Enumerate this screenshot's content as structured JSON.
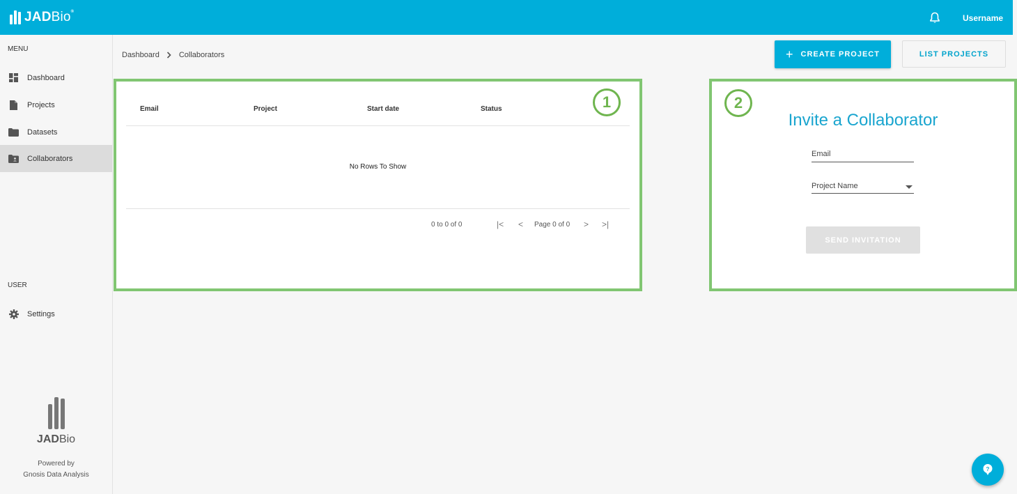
{
  "app": {
    "logo_text_bold": "JAD",
    "logo_text_light": "Bio",
    "logo_mark": "®"
  },
  "header": {
    "username": "Username",
    "notification_icon": "bell-icon"
  },
  "sidebar": {
    "menu_label": "MENU",
    "items": [
      {
        "label": "Dashboard",
        "icon": "dashboard-icon"
      },
      {
        "label": "Projects",
        "icon": "file-icon"
      },
      {
        "label": "Datasets",
        "icon": "folder-icon"
      },
      {
        "label": "Collaborators",
        "icon": "shared-folder-icon",
        "active": true
      }
    ],
    "user_label": "USER",
    "settings": {
      "label": "Settings",
      "icon": "gear-icon"
    },
    "footer_logo_bold": "JAD",
    "footer_logo_light": "Bio",
    "powered_by": "Powered by",
    "company": "Gnosis Data Analysis"
  },
  "breadcrumb": {
    "items": [
      "Dashboard",
      "Collaborators"
    ],
    "separator": ">"
  },
  "actions": {
    "create_label": "CREATE PROJECT",
    "create_icon": "plus-icon",
    "list_label": "LIST PROJECTS"
  },
  "collaborators_table": {
    "badge": "1",
    "columns": [
      "Email",
      "Project",
      "Start date",
      "Status"
    ],
    "empty_message": "No Rows To Show",
    "summary": "0 to 0 of 0",
    "page_label": "Page 0 of 0",
    "pager_icons": {
      "first": "|<",
      "prev": "<",
      "next": ">",
      "last": ">|"
    }
  },
  "invite_form": {
    "badge": "2",
    "title": "Invite a Collaborator",
    "email_placeholder": "Email",
    "project_placeholder": "Project Name",
    "send_label": "SEND INVITATION"
  },
  "colors": {
    "brand": "#00aeda",
    "highlight_border": "#81c672",
    "disabled": "#e0e0e0"
  },
  "help": {
    "icon": "help-question-icon"
  }
}
